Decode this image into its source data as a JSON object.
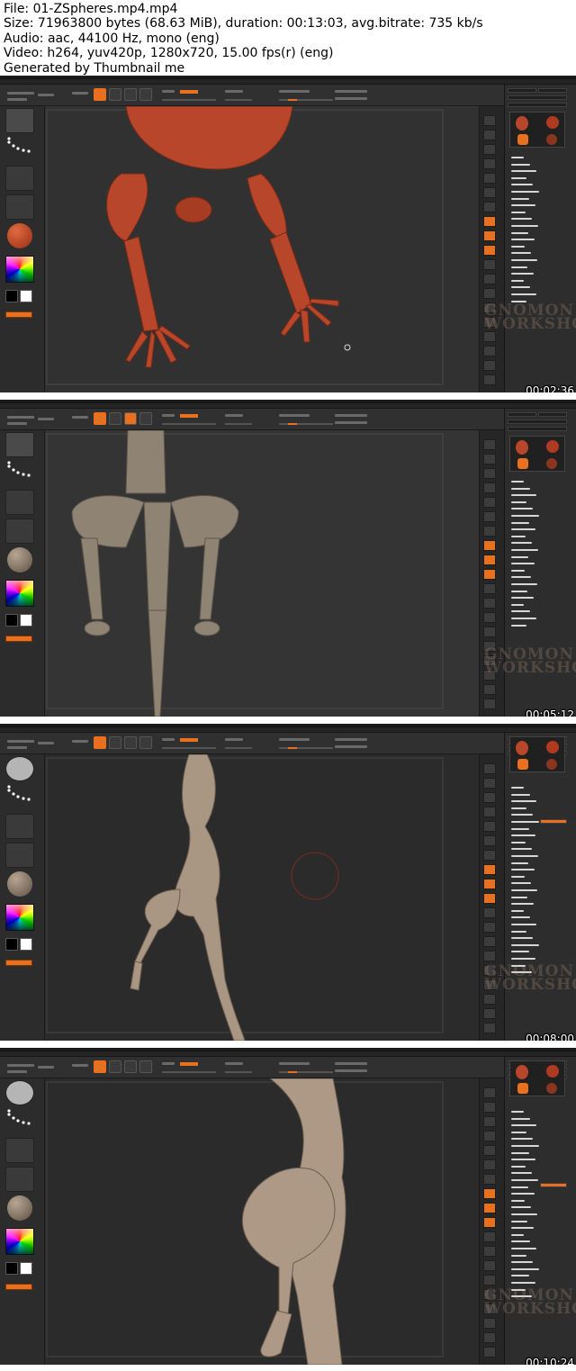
{
  "header": {
    "file": "File: 01-ZSpheres.mp4.mp4",
    "size": "Size: 71963800 bytes (68.63 MiB), duration: 00:13:03, avg.bitrate: 735 kb/s",
    "audio": "Audio: aac, 44100 Hz, mono (eng)",
    "video": "Video: h264, yuv420p, 1280x720, 15.00 fps(r) (eng)",
    "generated": "Generated by Thumbnail me"
  },
  "frames": [
    {
      "timestamp": "00:02:36",
      "logo": "GNOMON WORKSHOP"
    },
    {
      "timestamp": "00:05:12",
      "logo": "GNOMON WORKSHOP"
    },
    {
      "timestamp": "00:08:00",
      "logo": "GNOMON WORKSHOP"
    },
    {
      "timestamp": "00:10:24",
      "logo": "GNOMON WORKSHOP"
    }
  ],
  "colors": {
    "accent": "#e8701e",
    "zsphere_model": "#b8462a",
    "clay_model": "#a99683",
    "background": "#2a2a2a"
  },
  "icons": [
    "brush-icon",
    "stroke-dots-icon",
    "alpha-icon",
    "texture-icon",
    "material-sphere-icon",
    "color-picker-icon"
  ]
}
